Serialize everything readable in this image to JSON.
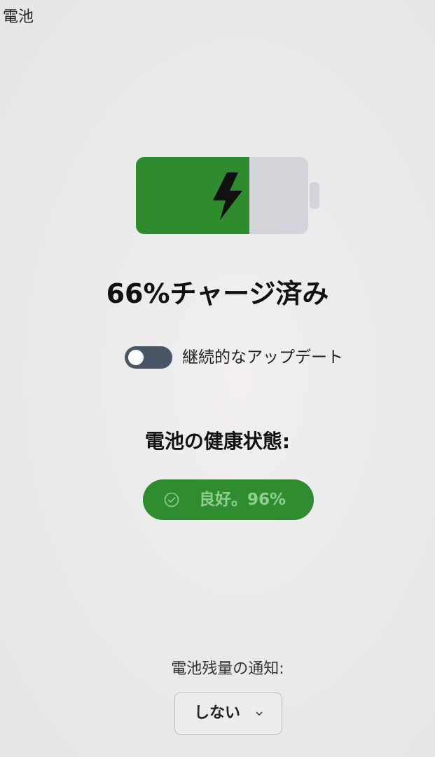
{
  "window": {
    "title": "電池"
  },
  "battery": {
    "level": 0.66,
    "charging": true,
    "fill_color": "#2e8b2e",
    "empty_color": "#d2d4d9",
    "bolt_color": "#111111",
    "charge_text": "66%チャージ済み"
  },
  "continuous_update": {
    "enabled": false,
    "label": "継続的なアップデート"
  },
  "health": {
    "title": "電池の健康状態:",
    "status_text": "良好。96%",
    "icon": "check-circle-icon",
    "color": "#2f8d2f"
  },
  "notification": {
    "label": "電池残量の通知:",
    "selected": "しない",
    "icon": "chevron-down-icon"
  }
}
